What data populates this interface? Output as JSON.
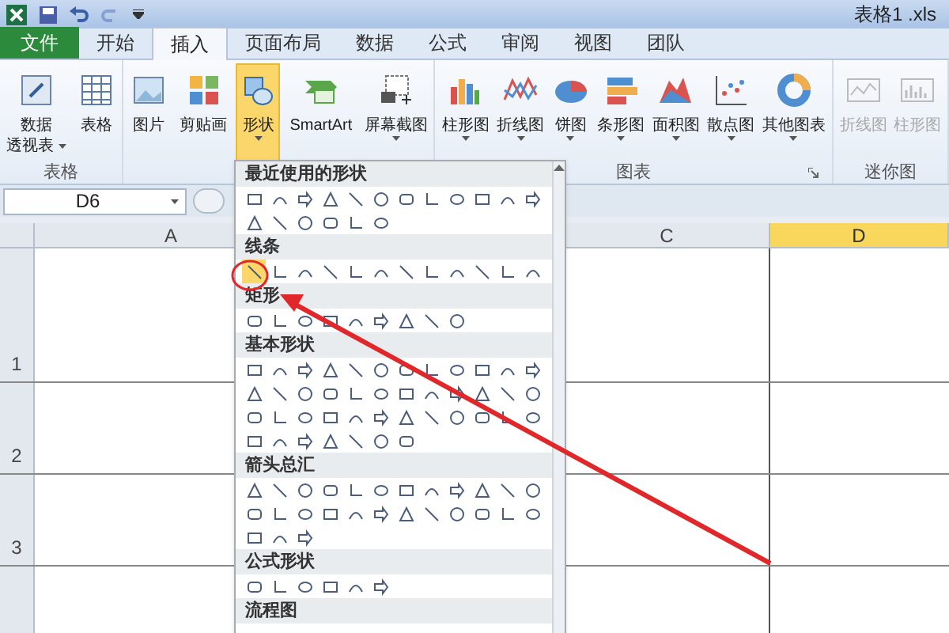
{
  "title_bar": {
    "title": "表格1 .xls"
  },
  "tabs": [
    {
      "label": "文件",
      "kind": "file",
      "selected": false
    },
    {
      "label": "开始",
      "kind": "tab",
      "selected": false
    },
    {
      "label": "插入",
      "kind": "tab",
      "selected": true
    },
    {
      "label": "页面布局",
      "kind": "tab",
      "selected": false
    },
    {
      "label": "数据",
      "kind": "tab",
      "selected": false
    },
    {
      "label": "公式",
      "kind": "tab",
      "selected": false
    },
    {
      "label": "审阅",
      "kind": "tab",
      "selected": false
    },
    {
      "label": "视图",
      "kind": "tab",
      "selected": false
    },
    {
      "label": "团队",
      "kind": "tab",
      "selected": false
    }
  ],
  "ribbon": {
    "groups": [
      {
        "label": "表格",
        "buttons": [
          {
            "lines": [
              "数据",
              "透视表"
            ],
            "has_menu": true,
            "selected": false,
            "disabled": false
          },
          {
            "lines": [
              "表格"
            ],
            "has_menu": false,
            "selected": false,
            "disabled": false
          }
        ]
      },
      {
        "buttons": [
          {
            "lines": [
              "图片"
            ],
            "has_menu": false,
            "selected": false,
            "disabled": false
          },
          {
            "lines": [
              "剪贴画"
            ],
            "has_menu": false,
            "selected": false,
            "disabled": false
          },
          {
            "lines": [
              "形状"
            ],
            "has_menu": true,
            "selected": true,
            "disabled": false
          },
          {
            "lines": [
              "SmartArt"
            ],
            "has_menu": false,
            "selected": false,
            "disabled": false
          },
          {
            "lines": [
              "屏幕截图"
            ],
            "has_menu": true,
            "selected": false,
            "disabled": false
          }
        ]
      },
      {
        "label": "图表",
        "launcher": true,
        "buttons": [
          {
            "lines": [
              "柱形图"
            ],
            "has_menu": true,
            "selected": false,
            "disabled": false
          },
          {
            "lines": [
              "折线图"
            ],
            "has_menu": true,
            "selected": false,
            "disabled": false
          },
          {
            "lines": [
              "饼图"
            ],
            "has_menu": true,
            "selected": false,
            "disabled": false
          },
          {
            "lines": [
              "条形图"
            ],
            "has_menu": true,
            "selected": false,
            "disabled": false
          },
          {
            "lines": [
              "面积图"
            ],
            "has_menu": true,
            "selected": false,
            "disabled": false
          },
          {
            "lines": [
              "散点图"
            ],
            "has_menu": true,
            "selected": false,
            "disabled": false
          },
          {
            "lines": [
              "其他图表"
            ],
            "has_menu": true,
            "selected": false,
            "disabled": false
          }
        ]
      },
      {
        "label": "迷你图",
        "buttons": [
          {
            "lines": [
              "折线图"
            ],
            "has_menu": false,
            "selected": false,
            "disabled": true
          },
          {
            "lines": [
              "柱形图"
            ],
            "has_menu": false,
            "selected": false,
            "disabled": true
          }
        ]
      }
    ]
  },
  "formula_bar": {
    "name_box": "D6"
  },
  "sheet": {
    "columns": [
      {
        "label": "A",
        "selected": false
      },
      {
        "label": "C",
        "selected": false
      },
      {
        "label": "D",
        "selected": true
      }
    ],
    "rows": [
      {
        "label": "1"
      },
      {
        "label": "2"
      },
      {
        "label": "3"
      }
    ]
  },
  "shapes_menu": {
    "sections": [
      {
        "title": "最近使用的形状"
      },
      {
        "title": "线条",
        "highlight_first": true
      },
      {
        "title": "矩形"
      },
      {
        "title": "基本形状"
      },
      {
        "title": "箭头总汇"
      },
      {
        "title": "公式形状"
      },
      {
        "title": "流程图"
      }
    ]
  }
}
